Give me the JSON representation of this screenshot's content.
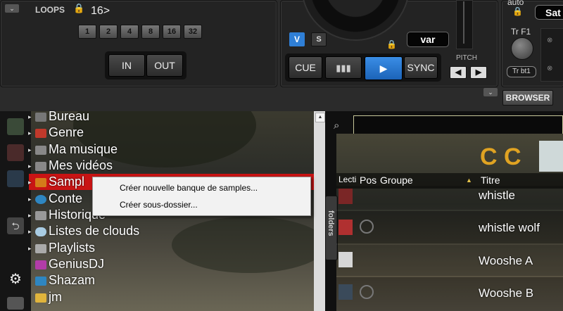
{
  "deck": {
    "loops_label": "LOOPS",
    "loops_value": "16>",
    "loop_sizes": [
      "1",
      "2",
      "4",
      "8",
      "16",
      "32"
    ],
    "in_label": "IN",
    "out_label": "OUT",
    "v_label": "V",
    "s_label": "S",
    "var_label": "var",
    "cue_label": "CUE",
    "play_icon": "play-icon",
    "sync_label": "SYNC",
    "pitch_label": "PITCH",
    "auto_label": "auto",
    "sat_label": "Sat",
    "trf1_label": "Tr F1",
    "trbt1_label": "Tr bt1",
    "browser_label": "BROWSER"
  },
  "tree": {
    "items": [
      {
        "label": "Bureau",
        "icon": "folder-icon"
      },
      {
        "label": "Genre",
        "icon": "genre-icon"
      },
      {
        "label": "Ma musique",
        "icon": "music-folder-icon"
      },
      {
        "label": "Mes vidéos",
        "icon": "video-folder-icon"
      },
      {
        "label": "Samples",
        "icon": "samples-icon"
      },
      {
        "label": "Contenus",
        "icon": "globe-icon"
      },
      {
        "label": "Historique",
        "icon": "history-icon"
      },
      {
        "label": "Listes de clouds",
        "icon": "cloud-icon"
      },
      {
        "label": "Playlists",
        "icon": "folder-icon"
      },
      {
        "label": "GeniusDJ",
        "icon": "geniusdj-icon"
      },
      {
        "label": "Shazam",
        "icon": "shazam-icon"
      },
      {
        "label": "jm",
        "icon": "folder-icon"
      }
    ],
    "visible_samples": "Sampl",
    "visible_contenus": "Conte"
  },
  "context_menu": {
    "items": [
      "Créer nouvelle banque de samples...",
      "Créer sous-dossier..."
    ]
  },
  "list": {
    "folders_tab": "folders",
    "headers": {
      "lecture": "Lecti",
      "pos": "Pos",
      "groupe": "Groupe",
      "titre": "Titre"
    },
    "rows": [
      {
        "titre": "whistle"
      },
      {
        "titre": "whistle wolf"
      },
      {
        "titre": "Wooshe A"
      },
      {
        "titre": "Wooshe B"
      }
    ]
  },
  "colors": {
    "accent_blue": "#2f7fd6",
    "samples_highlight": "#c91414"
  }
}
